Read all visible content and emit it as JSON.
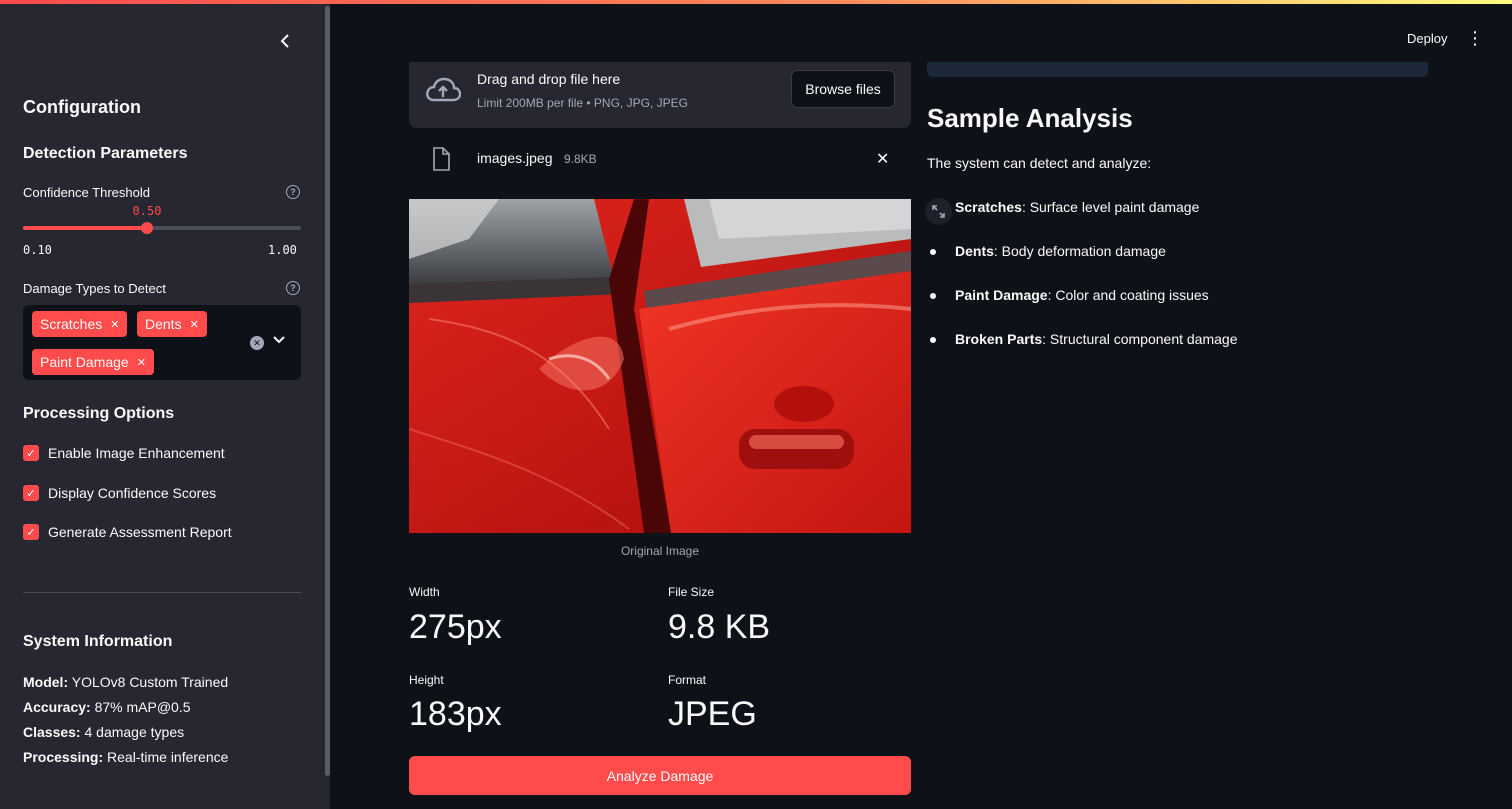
{
  "sidebar": {
    "collapse_icon": "chevron-left-icon",
    "title": "Configuration",
    "detection_heading": "Detection Parameters",
    "confidence": {
      "label": "Confidence Threshold",
      "value": "0.50",
      "value_num": 0.5,
      "min": "0.10",
      "max": "1.00",
      "min_num": 0.1,
      "max_num": 1.0
    },
    "damage_types": {
      "label": "Damage Types to Detect",
      "selected": [
        "Scratches",
        "Dents",
        "Paint Damage"
      ]
    },
    "processing_heading": "Processing Options",
    "options": [
      {
        "label": "Enable Image Enhancement",
        "checked": true
      },
      {
        "label": "Display Confidence Scores",
        "checked": true
      },
      {
        "label": "Generate Assessment Report",
        "checked": true
      }
    ],
    "system_heading": "System Information",
    "system_info": [
      {
        "key": "Model:",
        "value": " YOLOv8 Custom Trained"
      },
      {
        "key": "Accuracy:",
        "value": " 87% mAP@0.5"
      },
      {
        "key": "Classes:",
        "value": " 4 damage types"
      },
      {
        "key": "Processing:",
        "value": " Real-time inference"
      }
    ]
  },
  "header": {
    "deploy_label": "Deploy",
    "menu_icon": "kebab-menu-icon"
  },
  "uploader": {
    "title": "Drag and drop file here",
    "subtitle": "Limit 200MB per file • PNG, JPG, JPEG",
    "browse_label": "Browse files",
    "file": {
      "name": "images.jpeg",
      "size": "9.8KB"
    }
  },
  "image": {
    "caption": "Original Image"
  },
  "metrics": [
    {
      "label": "Width",
      "value": "275px"
    },
    {
      "label": "File Size",
      "value": "9.8 KB"
    },
    {
      "label": "Height",
      "value": "183px"
    },
    {
      "label": "Format",
      "value": "JPEG"
    }
  ],
  "analyze_label": "Analyze Damage",
  "sample": {
    "title": "Sample Analysis",
    "intro": "The system can detect and analyze:",
    "items": [
      {
        "key": "Scratches",
        "desc": ": Surface level paint damage"
      },
      {
        "key": "Dents",
        "desc": ": Body deformation damage"
      },
      {
        "key": "Paint Damage",
        "desc": ": Color and coating issues"
      },
      {
        "key": "Broken Parts",
        "desc": ": Structural component damage"
      }
    ]
  },
  "colors": {
    "accent": "#ff4b4b",
    "background": "#0e1117",
    "sidebar": "#262730"
  }
}
